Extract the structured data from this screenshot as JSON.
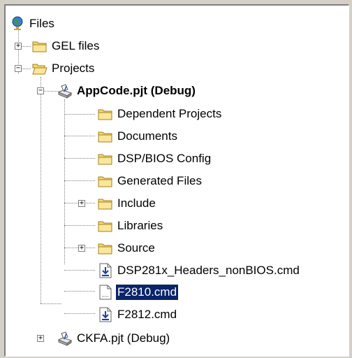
{
  "tree": {
    "root_label": "Files",
    "items": [
      {
        "label": "GEL files"
      },
      {
        "label": "Projects"
      },
      {
        "label": "AppCode.pjt (Debug)"
      },
      {
        "label": "Dependent Projects"
      },
      {
        "label": "Documents"
      },
      {
        "label": "DSP/BIOS Config"
      },
      {
        "label": "Generated Files"
      },
      {
        "label": "Include"
      },
      {
        "label": "Libraries"
      },
      {
        "label": "Source"
      },
      {
        "label": "DSP281x_Headers_nonBIOS.cmd"
      },
      {
        "label": "F2810.cmd"
      },
      {
        "label": "F2812.cmd"
      },
      {
        "label": "CKFA.pjt (Debug)"
      }
    ],
    "expander_collapsed": "+",
    "expander_expanded": "−",
    "selected_item": "F2810.cmd"
  },
  "colors": {
    "selection": "#0a246a",
    "folder": "#f6d86b",
    "window_bg": "#d4d0c8"
  }
}
